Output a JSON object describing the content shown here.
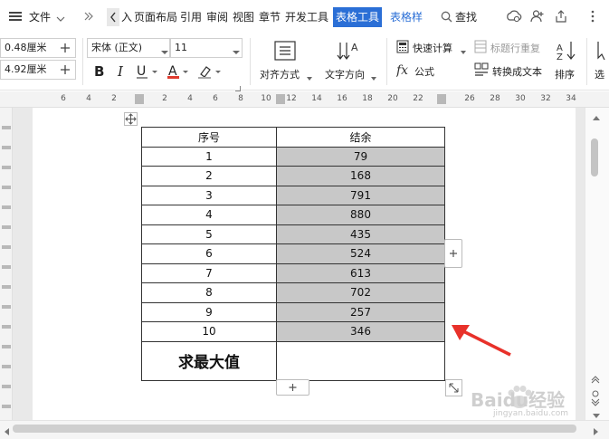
{
  "menubar": {
    "file_label": "文件",
    "tabs": [
      "入",
      "页面布局",
      "引用",
      "审阅",
      "视图",
      "章节",
      "开发工具",
      "表格工具",
      "表格样"
    ],
    "active_tab": "表格工具",
    "search_label": "查找"
  },
  "ribbon": {
    "height_value": "0.48厘米",
    "width_value": "4.92厘米",
    "font_name": "宋体 (正文)",
    "font_size": "11",
    "align_label": "对齐方式",
    "text_direction_label": "文字方向",
    "quick_calc_label": "快速计算",
    "title_row_repeat_label": "标题行重复",
    "formula_label": "公式",
    "convert_text_label": "转换成文本",
    "sort_label": "排序",
    "select_label": "选",
    "font_color_accent": "#e03b2e"
  },
  "ruler": {
    "labels": [
      "6",
      "4",
      "2",
      "2",
      "4",
      "6",
      "8",
      "10",
      "12",
      "14",
      "16",
      "18",
      "20",
      "22",
      "26",
      "28",
      "30",
      "32",
      "34"
    ]
  },
  "table": {
    "header": [
      "序号",
      "结余"
    ],
    "rows": [
      [
        "1",
        "79"
      ],
      [
        "2",
        "168"
      ],
      [
        "3",
        "791"
      ],
      [
        "4",
        "880"
      ],
      [
        "5",
        "435"
      ],
      [
        "6",
        "524"
      ],
      [
        "7",
        "613"
      ],
      [
        "8",
        "702"
      ],
      [
        "9",
        "257"
      ],
      [
        "10",
        "346"
      ]
    ],
    "footer_label": "求最大值",
    "footer_value": ""
  },
  "annotation": {
    "arrow_color": "#e8312a"
  },
  "watermark": {
    "text": "Baidu经验",
    "url_text": "jingyan.baidu.com"
  }
}
